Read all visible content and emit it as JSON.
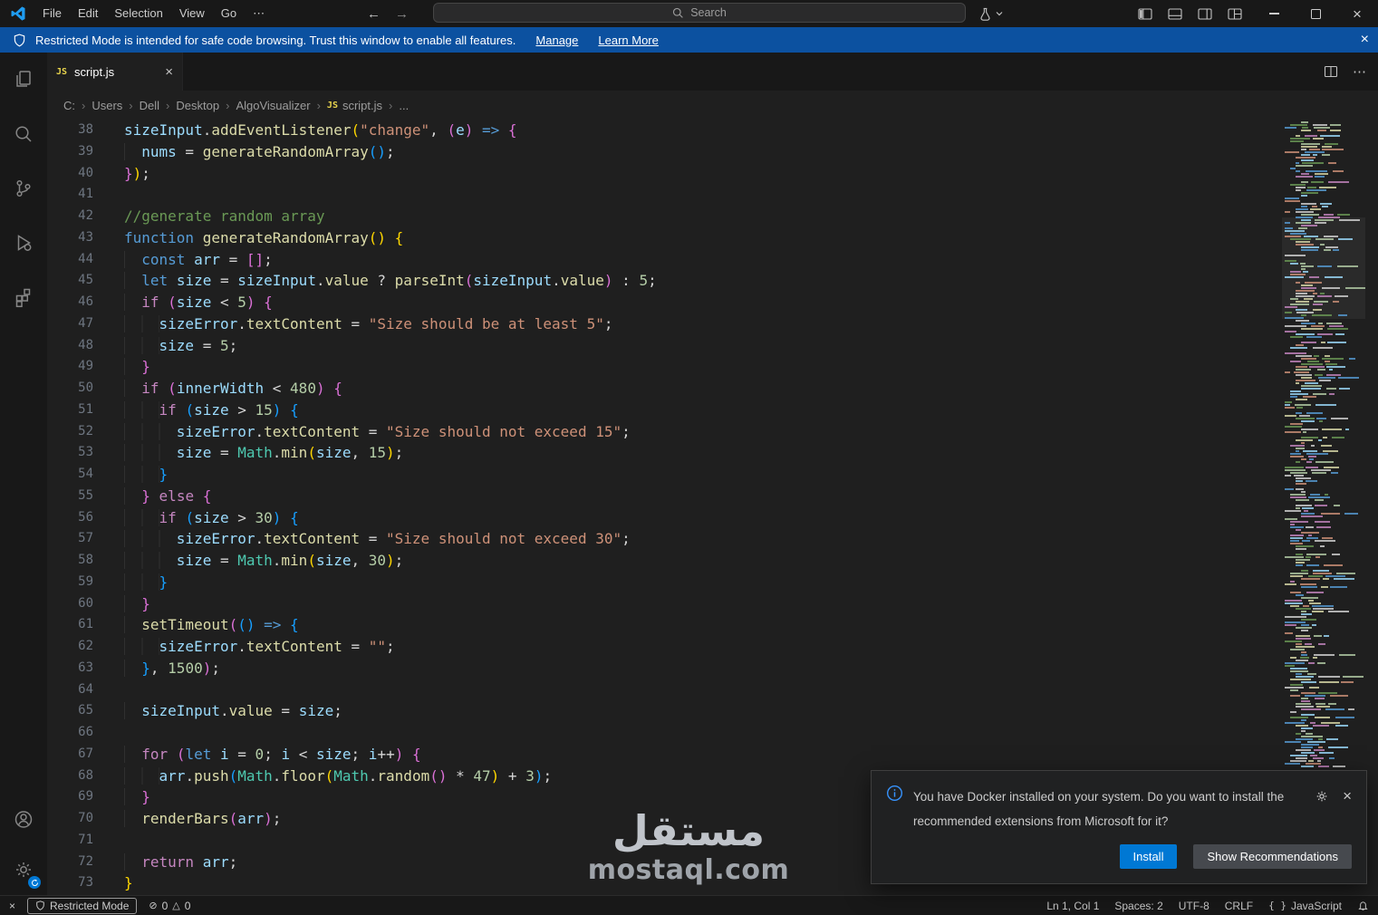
{
  "colors": {
    "chrome-bg": "#181818",
    "editor-bg": "#1f1f1f",
    "banner-bg": "#0c51a0",
    "accent": "#0078d4",
    "tab-fg": "#ffffff",
    "line-number": "#6e7681",
    "js-badge": "#e8d44d",
    "tk-k": "#569cd6",
    "tk-c": "#c586c0",
    "tk-f": "#dcdcaa",
    "tk-v": "#9cdcfe",
    "tk-s": "#ce9178",
    "tk-n": "#b5cea8",
    "tk-m": "#6a9955",
    "tk-p": "#d4d4d4",
    "tk-t": "#4ec9b0",
    "tk-b1": "#ffd700",
    "tk-b2": "#da70d6",
    "tk-b3": "#179fff"
  },
  "window": {
    "menu": [
      "File",
      "Edit",
      "Selection",
      "View",
      "Go",
      "⋯"
    ],
    "search_placeholder": "Search"
  },
  "banner": {
    "text": "Restricted Mode is intended for safe code browsing. Trust this window to enable all features.",
    "manage_label": "Manage",
    "learn_more_label": "Learn More"
  },
  "tab": {
    "label": "script.js"
  },
  "breadcrumb": {
    "items": [
      "C:",
      "Users",
      "Dell",
      "Desktop",
      "AlgoVisualizer",
      "script.js",
      "..."
    ],
    "file_index": 5
  },
  "editor": {
    "lines": [
      {
        "n": 38,
        "t": [
          [
            "v",
            "sizeInput"
          ],
          [
            "p",
            "."
          ],
          [
            "f",
            "addEventListener"
          ],
          [
            "b1",
            "("
          ],
          [
            "s",
            "\"change\""
          ],
          [
            "p",
            ", "
          ],
          [
            "b2",
            "("
          ],
          [
            "v",
            "e"
          ],
          [
            "b2",
            ")"
          ],
          [
            "p",
            " "
          ],
          [
            "k",
            "=>"
          ],
          [
            "p",
            " "
          ],
          [
            "b2",
            "{"
          ]
        ]
      },
      {
        "n": 39,
        "t": [
          [
            "w",
            "  "
          ],
          [
            "v",
            "nums"
          ],
          [
            "p",
            " = "
          ],
          [
            "f",
            "generateRandomArray"
          ],
          [
            "b3",
            "()"
          ],
          [
            "p",
            ";"
          ]
        ]
      },
      {
        "n": 40,
        "t": [
          [
            "b2",
            "}"
          ],
          [
            "b1",
            ")"
          ],
          [
            "p",
            ";"
          ]
        ]
      },
      {
        "n": 41,
        "t": []
      },
      {
        "n": 42,
        "t": [
          [
            "m",
            "//generate random array"
          ]
        ]
      },
      {
        "n": 43,
        "t": [
          [
            "k",
            "function"
          ],
          [
            "p",
            " "
          ],
          [
            "f",
            "generateRandomArray"
          ],
          [
            "b1",
            "()"
          ],
          [
            "p",
            " "
          ],
          [
            "b1",
            "{"
          ]
        ]
      },
      {
        "n": 44,
        "t": [
          [
            "w",
            "  "
          ],
          [
            "k",
            "const"
          ],
          [
            "p",
            " "
          ],
          [
            "v",
            "arr"
          ],
          [
            "p",
            " = "
          ],
          [
            "b2",
            "[]"
          ],
          [
            "p",
            ";"
          ]
        ]
      },
      {
        "n": 45,
        "t": [
          [
            "w",
            "  "
          ],
          [
            "k",
            "let"
          ],
          [
            "p",
            " "
          ],
          [
            "v",
            "size"
          ],
          [
            "p",
            " = "
          ],
          [
            "v",
            "sizeInput"
          ],
          [
            "p",
            "."
          ],
          [
            "f",
            "value"
          ],
          [
            "p",
            " ? "
          ],
          [
            "f",
            "parseInt"
          ],
          [
            "b2",
            "("
          ],
          [
            "v",
            "sizeInput"
          ],
          [
            "p",
            "."
          ],
          [
            "f",
            "value"
          ],
          [
            "b2",
            ")"
          ],
          [
            "p",
            " : "
          ],
          [
            "n",
            "5"
          ],
          [
            "p",
            ";"
          ]
        ]
      },
      {
        "n": 46,
        "t": [
          [
            "w",
            "  "
          ],
          [
            "c",
            "if"
          ],
          [
            "p",
            " "
          ],
          [
            "b2",
            "("
          ],
          [
            "v",
            "size"
          ],
          [
            "p",
            " < "
          ],
          [
            "n",
            "5"
          ],
          [
            "b2",
            ")"
          ],
          [
            "p",
            " "
          ],
          [
            "b2",
            "{"
          ]
        ]
      },
      {
        "n": 47,
        "t": [
          [
            "w",
            "    "
          ],
          [
            "v",
            "sizeError"
          ],
          [
            "p",
            "."
          ],
          [
            "f",
            "textContent"
          ],
          [
            "p",
            " = "
          ],
          [
            "s",
            "\"Size should be at least 5\""
          ],
          [
            "p",
            ";"
          ]
        ]
      },
      {
        "n": 48,
        "t": [
          [
            "w",
            "    "
          ],
          [
            "v",
            "size"
          ],
          [
            "p",
            " = "
          ],
          [
            "n",
            "5"
          ],
          [
            "p",
            ";"
          ]
        ]
      },
      {
        "n": 49,
        "t": [
          [
            "w",
            "  "
          ],
          [
            "b2",
            "}"
          ]
        ]
      },
      {
        "n": 50,
        "t": [
          [
            "w",
            "  "
          ],
          [
            "c",
            "if"
          ],
          [
            "p",
            " "
          ],
          [
            "b2",
            "("
          ],
          [
            "v",
            "innerWidth"
          ],
          [
            "p",
            " < "
          ],
          [
            "n",
            "480"
          ],
          [
            "b2",
            ")"
          ],
          [
            "p",
            " "
          ],
          [
            "b2",
            "{"
          ]
        ]
      },
      {
        "n": 51,
        "t": [
          [
            "w",
            "    "
          ],
          [
            "c",
            "if"
          ],
          [
            "p",
            " "
          ],
          [
            "b3",
            "("
          ],
          [
            "v",
            "size"
          ],
          [
            "p",
            " > "
          ],
          [
            "n",
            "15"
          ],
          [
            "b3",
            ")"
          ],
          [
            "p",
            " "
          ],
          [
            "b3",
            "{"
          ]
        ]
      },
      {
        "n": 52,
        "t": [
          [
            "w",
            "      "
          ],
          [
            "v",
            "sizeError"
          ],
          [
            "p",
            "."
          ],
          [
            "f",
            "textContent"
          ],
          [
            "p",
            " = "
          ],
          [
            "s",
            "\"Size should not exceed 15\""
          ],
          [
            "p",
            ";"
          ]
        ]
      },
      {
        "n": 53,
        "t": [
          [
            "w",
            "      "
          ],
          [
            "v",
            "size"
          ],
          [
            "p",
            " = "
          ],
          [
            "t",
            "Math"
          ],
          [
            "p",
            "."
          ],
          [
            "f",
            "min"
          ],
          [
            "b1",
            "("
          ],
          [
            "v",
            "size"
          ],
          [
            "p",
            ", "
          ],
          [
            "n",
            "15"
          ],
          [
            "b1",
            ")"
          ],
          [
            "p",
            ";"
          ]
        ]
      },
      {
        "n": 54,
        "t": [
          [
            "w",
            "    "
          ],
          [
            "b3",
            "}"
          ]
        ]
      },
      {
        "n": 55,
        "t": [
          [
            "w",
            "  "
          ],
          [
            "b2",
            "}"
          ],
          [
            "p",
            " "
          ],
          [
            "c",
            "else"
          ],
          [
            "p",
            " "
          ],
          [
            "b2",
            "{"
          ]
        ]
      },
      {
        "n": 56,
        "t": [
          [
            "w",
            "    "
          ],
          [
            "c",
            "if"
          ],
          [
            "p",
            " "
          ],
          [
            "b3",
            "("
          ],
          [
            "v",
            "size"
          ],
          [
            "p",
            " > "
          ],
          [
            "n",
            "30"
          ],
          [
            "b3",
            ")"
          ],
          [
            "p",
            " "
          ],
          [
            "b3",
            "{"
          ]
        ]
      },
      {
        "n": 57,
        "t": [
          [
            "w",
            "      "
          ],
          [
            "v",
            "sizeError"
          ],
          [
            "p",
            "."
          ],
          [
            "f",
            "textContent"
          ],
          [
            "p",
            " = "
          ],
          [
            "s",
            "\"Size should not exceed 30\""
          ],
          [
            "p",
            ";"
          ]
        ]
      },
      {
        "n": 58,
        "t": [
          [
            "w",
            "      "
          ],
          [
            "v",
            "size"
          ],
          [
            "p",
            " = "
          ],
          [
            "t",
            "Math"
          ],
          [
            "p",
            "."
          ],
          [
            "f",
            "min"
          ],
          [
            "b1",
            "("
          ],
          [
            "v",
            "size"
          ],
          [
            "p",
            ", "
          ],
          [
            "n",
            "30"
          ],
          [
            "b1",
            ")"
          ],
          [
            "p",
            ";"
          ]
        ]
      },
      {
        "n": 59,
        "t": [
          [
            "w",
            "    "
          ],
          [
            "b3",
            "}"
          ]
        ]
      },
      {
        "n": 60,
        "t": [
          [
            "w",
            "  "
          ],
          [
            "b2",
            "}"
          ]
        ]
      },
      {
        "n": 61,
        "t": [
          [
            "w",
            "  "
          ],
          [
            "f",
            "setTimeout"
          ],
          [
            "b2",
            "("
          ],
          [
            "b3",
            "()"
          ],
          [
            "p",
            " "
          ],
          [
            "k",
            "=>"
          ],
          [
            "p",
            " "
          ],
          [
            "b3",
            "{"
          ]
        ]
      },
      {
        "n": 62,
        "t": [
          [
            "w",
            "    "
          ],
          [
            "v",
            "sizeError"
          ],
          [
            "p",
            "."
          ],
          [
            "f",
            "textContent"
          ],
          [
            "p",
            " = "
          ],
          [
            "s",
            "\"\""
          ],
          [
            "p",
            ";"
          ]
        ]
      },
      {
        "n": 63,
        "t": [
          [
            "w",
            "  "
          ],
          [
            "b3",
            "}"
          ],
          [
            "p",
            ", "
          ],
          [
            "n",
            "1500"
          ],
          [
            "b2",
            ")"
          ],
          [
            "p",
            ";"
          ]
        ]
      },
      {
        "n": 64,
        "t": []
      },
      {
        "n": 65,
        "t": [
          [
            "w",
            "  "
          ],
          [
            "v",
            "sizeInput"
          ],
          [
            "p",
            "."
          ],
          [
            "f",
            "value"
          ],
          [
            "p",
            " = "
          ],
          [
            "v",
            "size"
          ],
          [
            "p",
            ";"
          ]
        ]
      },
      {
        "n": 66,
        "t": []
      },
      {
        "n": 67,
        "t": [
          [
            "w",
            "  "
          ],
          [
            "c",
            "for"
          ],
          [
            "p",
            " "
          ],
          [
            "b2",
            "("
          ],
          [
            "k",
            "let"
          ],
          [
            "p",
            " "
          ],
          [
            "v",
            "i"
          ],
          [
            "p",
            " = "
          ],
          [
            "n",
            "0"
          ],
          [
            "p",
            "; "
          ],
          [
            "v",
            "i"
          ],
          [
            "p",
            " < "
          ],
          [
            "v",
            "size"
          ],
          [
            "p",
            "; "
          ],
          [
            "v",
            "i"
          ],
          [
            "p",
            "++"
          ],
          [
            "b2",
            ")"
          ],
          [
            "p",
            " "
          ],
          [
            "b2",
            "{"
          ]
        ]
      },
      {
        "n": 68,
        "t": [
          [
            "w",
            "    "
          ],
          [
            "v",
            "arr"
          ],
          [
            "p",
            "."
          ],
          [
            "f",
            "push"
          ],
          [
            "b3",
            "("
          ],
          [
            "t",
            "Math"
          ],
          [
            "p",
            "."
          ],
          [
            "f",
            "floor"
          ],
          [
            "b1",
            "("
          ],
          [
            "t",
            "Math"
          ],
          [
            "p",
            "."
          ],
          [
            "f",
            "random"
          ],
          [
            "b2",
            "()"
          ],
          [
            "p",
            " * "
          ],
          [
            "n",
            "47"
          ],
          [
            "b1",
            ")"
          ],
          [
            "p",
            " + "
          ],
          [
            "n",
            "3"
          ],
          [
            "b3",
            ")"
          ],
          [
            "p",
            ";"
          ]
        ]
      },
      {
        "n": 69,
        "t": [
          [
            "w",
            "  "
          ],
          [
            "b2",
            "}"
          ]
        ]
      },
      {
        "n": 70,
        "t": [
          [
            "w",
            "  "
          ],
          [
            "f",
            "renderBars"
          ],
          [
            "b2",
            "("
          ],
          [
            "v",
            "arr"
          ],
          [
            "b2",
            ")"
          ],
          [
            "p",
            ";"
          ]
        ]
      },
      {
        "n": 71,
        "t": []
      },
      {
        "n": 72,
        "t": [
          [
            "w",
            "  "
          ],
          [
            "c",
            "return"
          ],
          [
            "p",
            " "
          ],
          [
            "v",
            "arr"
          ],
          [
            "p",
            ";"
          ]
        ]
      },
      {
        "n": 73,
        "t": [
          [
            "b1",
            "}"
          ]
        ]
      }
    ]
  },
  "notification": {
    "message": "You have Docker installed on your system. Do you want to install the recommended extensions from Microsoft for it?",
    "install_label": "Install",
    "show_recommendations_label": "Show Recommendations"
  },
  "status_bar": {
    "restricted_mode": "Restricted Mode",
    "errors": "0",
    "warnings": "0",
    "ln_col": "Ln 1, Col 1",
    "spaces": "Spaces: 2",
    "encoding": "UTF-8",
    "eol": "CRLF",
    "language": "JavaScript"
  },
  "watermark": {
    "arabic": "مستقل",
    "latin": "mostaql.com"
  }
}
